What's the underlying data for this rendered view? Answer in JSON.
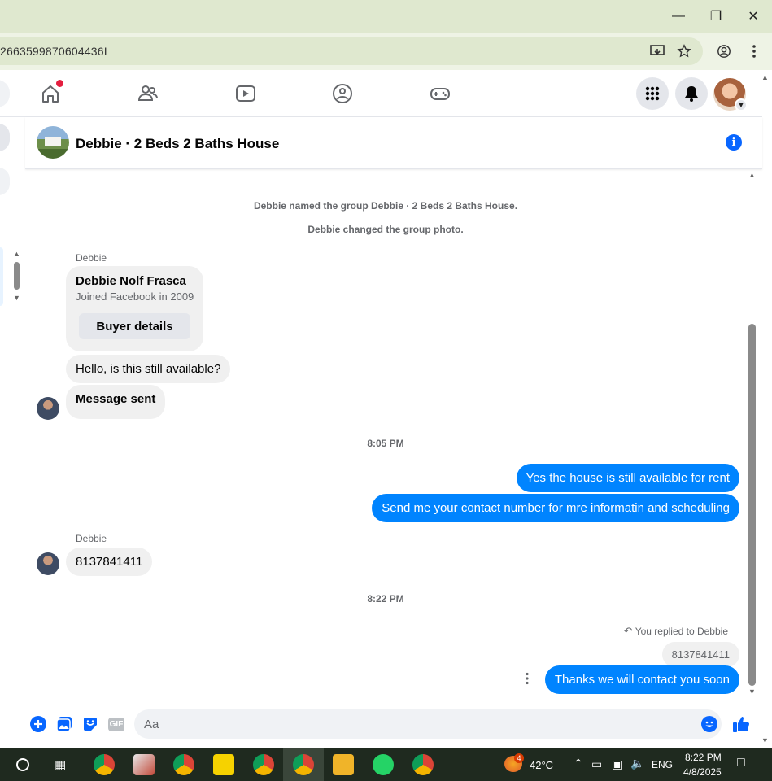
{
  "browser": {
    "url_fragment": "2663599870604436I",
    "window_controls": [
      "minimize-icon",
      "restore-icon",
      "close-icon"
    ],
    "address_icons": [
      "install-app-icon",
      "bookmark-star-icon",
      "profile-icon",
      "more-vert-icon"
    ]
  },
  "fb_nav": {
    "icons": [
      "home-icon",
      "friends-icon",
      "watch-icon",
      "groups-icon",
      "gaming-icon"
    ],
    "right_icons": [
      "menu-grid-icon",
      "notifications-bell-icon"
    ],
    "notification_dot_color": "#e41e3f"
  },
  "chat": {
    "title": "Debbie · 2 Beds 2 Baths House",
    "system_messages": [
      "Debbie named the group Debbie · 2 Beds 2 Baths House.",
      "Debbie changed the group photo."
    ],
    "sender_name_1": "Debbie",
    "profile_card": {
      "name": "Debbie Nolf Frasca",
      "subtitle": "Joined Facebook in 2009",
      "button": "Buyer details"
    },
    "incoming_1": "Hello, is this still available?",
    "incoming_2": "Message sent",
    "time_1": "8:05 PM",
    "outgoing_1": "Yes the house is still available for rent",
    "outgoing_2": "Send me your contact number for mre informatin and  scheduling",
    "sender_name_2": "Debbie",
    "incoming_3": "8137841411",
    "time_2": "8:22 PM",
    "reply_note": "You replied to Debbie",
    "reply_quote": "8137841411",
    "outgoing_3": "Thanks we will contact you soon"
  },
  "composer": {
    "placeholder": "Aa",
    "icons": [
      "add-circle-icon",
      "photo-icon",
      "sticker-icon",
      "gif-icon",
      "emoji-icon",
      "like-thumb-icon"
    ],
    "gif_label": "GIF"
  },
  "taskbar": {
    "weather_badge": "4",
    "temperature": "42°C",
    "language": "ENG",
    "time": "8:22 PM",
    "date": "4/8/2025"
  },
  "colors": {
    "accent": "#0866ff",
    "outgoing_bubble": "#0084ff",
    "incoming_bubble": "#f0f0f0"
  }
}
